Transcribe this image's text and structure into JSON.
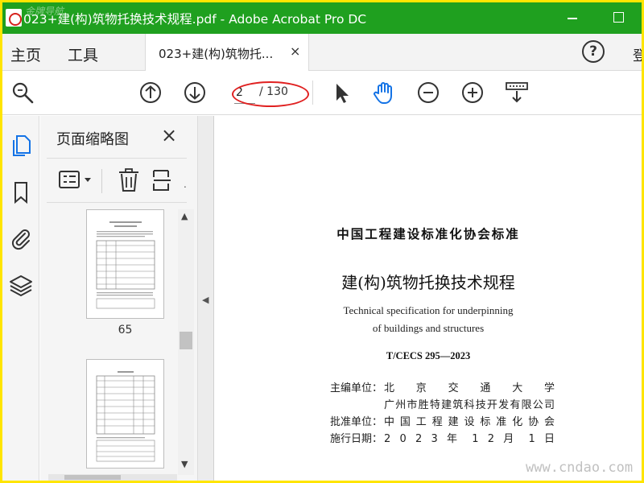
{
  "window": {
    "title": "023+建(构)筑物托换技术规程.pdf - Adobe Acrobat Pro DC",
    "watermark_top": "金牌导航"
  },
  "tabbar": {
    "home": "主页",
    "tools": "工具",
    "doc_tab": "023+建(构)筑物托...",
    "doc_tab_close": "×",
    "help": "?",
    "signin": "登"
  },
  "toolbar": {
    "page_current": "2",
    "page_total": "/ 130",
    "icons": [
      "search-zoom-icon",
      "page-up-icon",
      "page-down-icon",
      "select-cursor-icon",
      "hand-tool-icon",
      "zoom-out-icon",
      "zoom-in-icon",
      "scroll-mode-icon"
    ],
    "accent_color": "#1473e6",
    "annotation_color": "#e02020"
  },
  "rail": {
    "icons": [
      "pages-icon",
      "bookmark-icon",
      "attachment-icon",
      "layers-icon"
    ]
  },
  "panel": {
    "title": "页面缩略图",
    "close": "×",
    "thumbnails": [
      {
        "label": "65"
      },
      {
        "label": ""
      }
    ]
  },
  "document": {
    "org_heading": "中国工程建设标准化协会标准",
    "title_cn": "建(构)筑物托换技术规程",
    "title_en_1": "Technical specification for underpinning",
    "title_en_2": "of buildings and structures",
    "code": "T/CECS 295—2023",
    "lines": [
      {
        "label": "主编单位：",
        "value": "北　京　交　通　大　学"
      },
      {
        "label": "",
        "value": "广州市胜特建筑科技开发有限公司"
      },
      {
        "label": "批准单位：",
        "value": "中国工程建设标准化协会"
      },
      {
        "label": "施行日期：",
        "value": "2 0 2 3 年 1 2 月 1 日"
      }
    ]
  },
  "watermark_bottom": "www.cndao.com"
}
